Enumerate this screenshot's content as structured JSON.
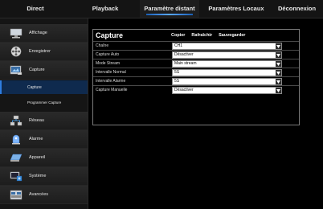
{
  "topnav": {
    "tabs": [
      {
        "label": "Direct",
        "active": false
      },
      {
        "label": "Playback",
        "active": false
      },
      {
        "label": "Paramètre distant",
        "active": true
      },
      {
        "label": "Paramètres Locaux",
        "active": false
      },
      {
        "label": "Déconnexion",
        "active": false
      }
    ]
  },
  "sidebar": {
    "items": [
      {
        "label": "Affichage",
        "icon": "monitor-icon"
      },
      {
        "label": "Enregistrer",
        "icon": "film-reel-icon"
      },
      {
        "label": "Capture",
        "icon": "camera-icon"
      },
      {
        "label": "Réseau",
        "icon": "network-icon"
      },
      {
        "label": "Alarme",
        "icon": "alarm-icon"
      },
      {
        "label": "Appareil",
        "icon": "hard-drive-icon"
      },
      {
        "label": "Système",
        "icon": "system-icon"
      },
      {
        "label": "Avancées",
        "icon": "advanced-icon"
      }
    ],
    "subitems": [
      {
        "label": "Capture",
        "selected": true
      },
      {
        "label": "Programmer Capture",
        "selected": false
      }
    ]
  },
  "capture": {
    "title": "Capture",
    "actions": [
      "Copier",
      "Rafraîchir",
      "Sauvegarder"
    ],
    "rows": [
      {
        "label": "Chaîne",
        "value": "CH1"
      },
      {
        "label": "Capture Auto",
        "value": "Désactiver"
      },
      {
        "label": "Mode Stream",
        "value": "Main stream"
      },
      {
        "label": "Intervalle Normal",
        "value": "5S"
      },
      {
        "label": "Intervalle Alarme",
        "value": "5S"
      },
      {
        "label": "Capture Manuelle",
        "value": "Désactiver"
      }
    ]
  },
  "colors": {
    "accent": "#2f7de0",
    "background": "#000000",
    "sidebar": "#1d1d1d"
  }
}
